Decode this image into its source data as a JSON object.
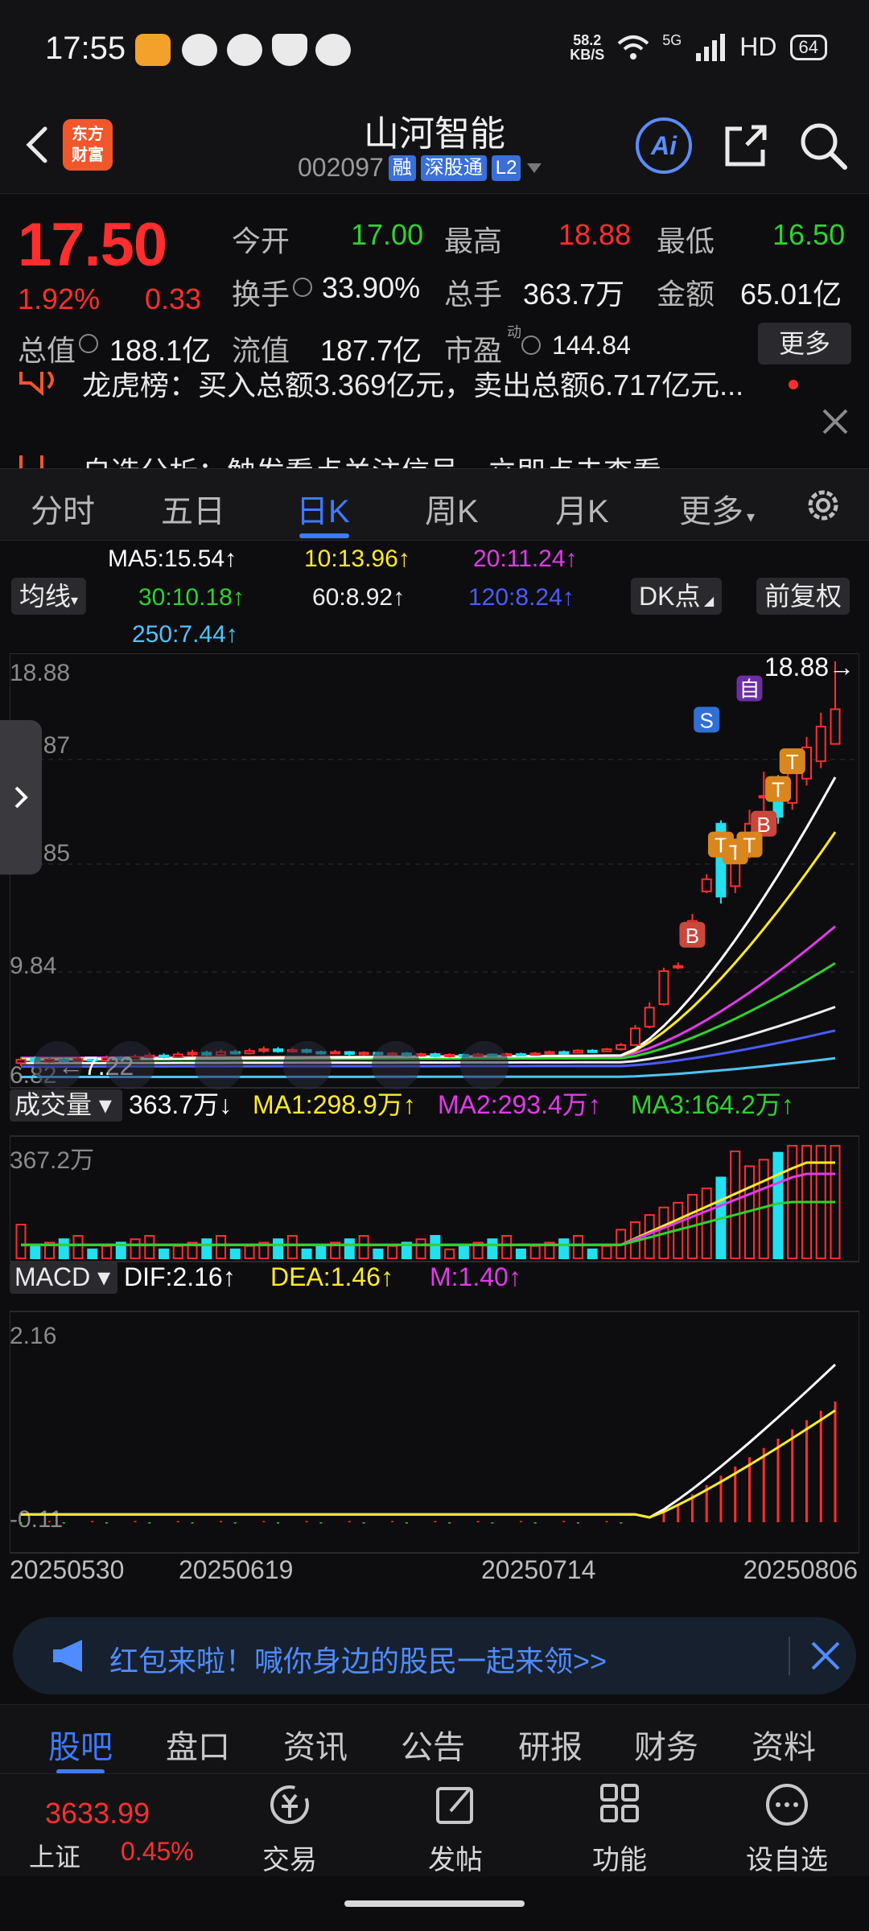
{
  "status_bar": {
    "time": "17:55",
    "net_speed_top": "58.2",
    "net_speed_bottom": "KB/S",
    "network_type": "5G",
    "hd_label": "HD",
    "battery": "64"
  },
  "header": {
    "logo_text_line1": "东方",
    "logo_text_line2": "财富",
    "stock_name": "山河智能",
    "stock_code": "002097",
    "tag_margin": "融",
    "tag_connect": "深股通",
    "tag_level": "L2",
    "ai_label": "Ai"
  },
  "quote": {
    "price": "17.50",
    "change_pct": "1.92%",
    "change_amt": "0.33",
    "open_label": "今开",
    "open_value": "17.00",
    "high_label": "最高",
    "high_value": "18.88",
    "low_label": "最低",
    "low_value": "16.50",
    "turnover_label": "换手",
    "turnover_value": "33.90%",
    "volume_label": "总手",
    "volume_value": "363.7万",
    "amount_label": "金额",
    "amount_value": "65.01亿",
    "mktcap_label": "总值",
    "mktcap_value": "188.1亿",
    "float_label": "流值",
    "float_value": "187.7亿",
    "pe_label": "市盈",
    "pe_sup": "动",
    "pe_value": "144.84",
    "more_label": "更多"
  },
  "news": {
    "line1": "龙虎榜：买入总额3.369亿元，卖出总额6.717亿元...",
    "line2": "自选分析：触发看点关注信号，立即点击查看"
  },
  "period_tabs": [
    "分时",
    "五日",
    "日K",
    "周K",
    "月K",
    "更多"
  ],
  "active_period": "日K",
  "ma_legend": {
    "ma_button": "均线",
    "ma5": "MA5:15.54↑",
    "ma10": "10:13.96↑",
    "ma20": "20:11.24↑",
    "ma30": "30:10.18↑",
    "ma60": "60:8.92↑",
    "ma120": "120:8.24↑",
    "ma250": "250:7.44↑",
    "dk_button": "DK点",
    "adjust_button": "前复权"
  },
  "colors": {
    "up": "#ff2e2e",
    "down": "#22e0f0",
    "accent": "#3d7bff",
    "ma5": "#ffffff",
    "ma10": "#ffea29",
    "ma20": "#e23ae8",
    "ma30": "#2fd22f",
    "ma60": "#eeeeee",
    "ma120": "#4a5cff",
    "ma250": "#4fc3ff"
  },
  "chart_data": {
    "type": "candlestick",
    "price_axis": {
      "ticks": [
        "18.88",
        "16.87",
        "14.85",
        "9.84",
        "6.82"
      ],
      "top": 18.88,
      "bottom": 6.82
    },
    "high_marker": "18.88→",
    "low_marker": "7.22",
    "signal_labels": {
      "self": "自",
      "sell": "S",
      "buy": "B",
      "t": "T"
    },
    "candles": [
      {
        "o": 7.3,
        "c": 7.4,
        "h": 7.48,
        "l": 7.22
      },
      {
        "o": 7.42,
        "c": 7.35,
        "h": 7.5,
        "l": 7.3
      },
      {
        "o": 7.34,
        "c": 7.4,
        "h": 7.45,
        "l": 7.3
      },
      {
        "o": 7.4,
        "c": 7.36,
        "h": 7.46,
        "l": 7.32
      },
      {
        "o": 7.36,
        "c": 7.42,
        "h": 7.48,
        "l": 7.33
      },
      {
        "o": 7.42,
        "c": 7.38,
        "h": 7.47,
        "l": 7.34
      },
      {
        "o": 7.38,
        "c": 7.45,
        "h": 7.52,
        "l": 7.35
      },
      {
        "o": 7.45,
        "c": 7.4,
        "h": 7.5,
        "l": 7.36
      },
      {
        "o": 7.4,
        "c": 7.48,
        "h": 7.55,
        "l": 7.38
      },
      {
        "o": 7.48,
        "c": 7.52,
        "h": 7.6,
        "l": 7.44
      },
      {
        "o": 7.52,
        "c": 7.47,
        "h": 7.58,
        "l": 7.43
      },
      {
        "o": 7.47,
        "c": 7.55,
        "h": 7.62,
        "l": 7.45
      },
      {
        "o": 7.55,
        "c": 7.6,
        "h": 7.68,
        "l": 7.5
      },
      {
        "o": 7.6,
        "c": 7.54,
        "h": 7.66,
        "l": 7.5
      },
      {
        "o": 7.54,
        "c": 7.62,
        "h": 7.7,
        "l": 7.52
      },
      {
        "o": 7.62,
        "c": 7.58,
        "h": 7.68,
        "l": 7.54
      },
      {
        "o": 7.58,
        "c": 7.65,
        "h": 7.72,
        "l": 7.55
      },
      {
        "o": 7.65,
        "c": 7.7,
        "h": 7.78,
        "l": 7.6
      },
      {
        "o": 7.7,
        "c": 7.64,
        "h": 7.76,
        "l": 7.6
      },
      {
        "o": 7.64,
        "c": 7.68,
        "h": 7.74,
        "l": 7.6
      },
      {
        "o": 7.68,
        "c": 7.62,
        "h": 7.72,
        "l": 7.58
      },
      {
        "o": 7.62,
        "c": 7.58,
        "h": 7.66,
        "l": 7.54
      },
      {
        "o": 7.58,
        "c": 7.62,
        "h": 7.68,
        "l": 7.55
      },
      {
        "o": 7.62,
        "c": 7.56,
        "h": 7.65,
        "l": 7.52
      },
      {
        "o": 7.56,
        "c": 7.6,
        "h": 7.64,
        "l": 7.52
      },
      {
        "o": 7.6,
        "c": 7.55,
        "h": 7.63,
        "l": 7.5
      },
      {
        "o": 7.55,
        "c": 7.58,
        "h": 7.62,
        "l": 7.52
      },
      {
        "o": 7.58,
        "c": 7.52,
        "h": 7.62,
        "l": 7.48
      },
      {
        "o": 7.52,
        "c": 7.56,
        "h": 7.6,
        "l": 7.48
      },
      {
        "o": 7.56,
        "c": 7.5,
        "h": 7.6,
        "l": 7.46
      },
      {
        "o": 7.5,
        "c": 7.54,
        "h": 7.58,
        "l": 7.46
      },
      {
        "o": 7.54,
        "c": 7.5,
        "h": 7.58,
        "l": 7.46
      },
      {
        "o": 7.5,
        "c": 7.55,
        "h": 7.6,
        "l": 7.48
      },
      {
        "o": 7.55,
        "c": 7.52,
        "h": 7.58,
        "l": 7.48
      },
      {
        "o": 7.52,
        "c": 7.56,
        "h": 7.6,
        "l": 7.5
      },
      {
        "o": 7.56,
        "c": 7.54,
        "h": 7.6,
        "l": 7.5
      },
      {
        "o": 7.54,
        "c": 7.58,
        "h": 7.62,
        "l": 7.52
      },
      {
        "o": 7.58,
        "c": 7.62,
        "h": 7.66,
        "l": 7.55
      },
      {
        "o": 7.62,
        "c": 7.6,
        "h": 7.66,
        "l": 7.56
      },
      {
        "o": 7.6,
        "c": 7.66,
        "h": 7.7,
        "l": 7.58
      },
      {
        "o": 7.66,
        "c": 7.64,
        "h": 7.7,
        "l": 7.6
      },
      {
        "o": 7.64,
        "c": 7.7,
        "h": 7.74,
        "l": 7.62
      },
      {
        "o": 7.7,
        "c": 7.82,
        "h": 7.88,
        "l": 7.66
      },
      {
        "o": 7.82,
        "c": 8.3,
        "h": 8.4,
        "l": 7.8
      },
      {
        "o": 8.35,
        "c": 8.9,
        "h": 9.05,
        "l": 8.3
      },
      {
        "o": 9.0,
        "c": 9.95,
        "h": 10.05,
        "l": 8.95
      },
      {
        "o": 10.1,
        "c": 10.1,
        "h": 10.2,
        "l": 10.0
      },
      {
        "o": 11.0,
        "c": 11.4,
        "h": 11.6,
        "l": 10.9
      },
      {
        "o": 12.25,
        "c": 12.6,
        "h": 12.75,
        "l": 12.2
      },
      {
        "o": 14.2,
        "c": 12.1,
        "h": 14.3,
        "l": 11.9
      },
      {
        "o": 12.4,
        "c": 13.2,
        "h": 13.4,
        "l": 12.2
      },
      {
        "o": 13.4,
        "c": 14.2,
        "h": 14.6,
        "l": 13.2
      },
      {
        "o": 15.0,
        "c": 15.0,
        "h": 15.7,
        "l": 14.4
      },
      {
        "o": 15.1,
        "c": 14.4,
        "h": 15.6,
        "l": 14.2
      },
      {
        "o": 14.8,
        "c": 15.8,
        "h": 16.1,
        "l": 14.6
      },
      {
        "o": 15.5,
        "c": 16.4,
        "h": 16.7,
        "l": 15.3
      },
      {
        "o": 16.0,
        "c": 17.0,
        "h": 17.4,
        "l": 15.8
      },
      {
        "o": 16.5,
        "c": 17.5,
        "h": 18.88,
        "l": 16.5
      }
    ],
    "ma_series": {
      "ma5": {
        "start": 7.4,
        "end": 15.54
      },
      "ma10": {
        "start": 7.42,
        "end": 13.96
      },
      "ma20": {
        "start": 7.45,
        "end": 11.24
      },
      "ma30": {
        "start": 7.4,
        "end": 10.18
      },
      "ma60": {
        "start": 7.3,
        "end": 8.92
      },
      "ma120": {
        "start": 7.2,
        "end": 8.24
      },
      "ma250": {
        "start": 6.9,
        "end": 7.44
      }
    },
    "x_labels": [
      "20250530",
      "20250619",
      "20250714",
      "20250806"
    ],
    "volume": {
      "button": "成交量",
      "value": "363.7万↓",
      "ma1": "MA1:298.9万↑",
      "ma2": "MA2:293.4万↑",
      "ma3": "MA3:164.2万↑",
      "axis_top": "367.2万",
      "max": 367.2
    },
    "macd": {
      "button": "MACD",
      "dif": "DIF:2.16↑",
      "dea": "DEA:1.46↑",
      "m": "M:1.40↑",
      "axis_top": "2.16",
      "axis_bottom": "-0.11"
    }
  },
  "promo": {
    "text": "红包来啦！喊你身边的股民一起来领>>"
  },
  "bottom_tabs": [
    "股吧",
    "盘口",
    "资讯",
    "公告",
    "研报",
    "财务",
    "资料"
  ],
  "active_bottom_tab": "股吧",
  "dock": {
    "index_value": "3633.99",
    "index_name": "上证",
    "index_pct": "0.45%",
    "trade_label": "交易",
    "post_label": "发帖",
    "function_label": "功能",
    "watchlist_label": "设自选"
  }
}
